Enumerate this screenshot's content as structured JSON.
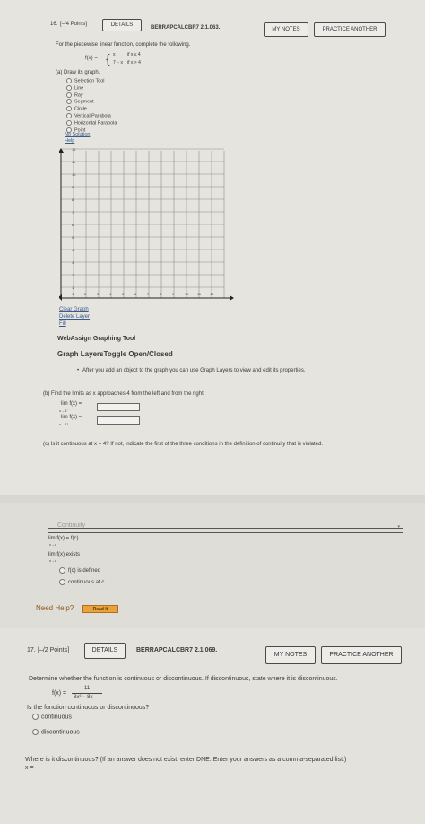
{
  "q16": {
    "number": "16.",
    "points": "[–/4 Points]",
    "details": "DETAILS",
    "code": "BERRAPCALCBR7 2.1.063.",
    "my_notes": "MY NOTES",
    "practice": "PRACTICE ANOTHER",
    "instruction": "For the piecewise linear function, complete the following.",
    "func_lhs": "f(x) =",
    "piece1_expr": "x",
    "piece1_cond": "if x ≤ 4",
    "piece2_expr": "7 − x",
    "piece2_cond": "if x > 4",
    "part_a": "(a)  Draw its graph.",
    "tools": [
      "Selection Tool",
      "Line",
      "Ray",
      "Segment",
      "Circle",
      "Vertical Parabola",
      "Horizontal Parabola",
      "Point"
    ],
    "no_solution": "No Solution",
    "help": "Help",
    "y_ticks": [
      "12",
      "11",
      "10",
      "9",
      "8",
      "7",
      "6",
      "5",
      "4",
      "3",
      "2",
      "1"
    ],
    "x_ticks": [
      "1",
      "2",
      "3",
      "4",
      "5",
      "6",
      "7",
      "8",
      "9",
      "10",
      "11",
      "12"
    ],
    "clear_graph": "Clear Graph",
    "delete_layer": "Delete Layer",
    "fill": "Fill",
    "tool_title": "WebAssign Graphing Tool",
    "layers_toggle": "Graph LayersToggle Open/Closed",
    "layers_note": "After you add an object to the graph you can use Graph Layers to view and edit its properties.",
    "part_b": "(b)  Find the limits as x approaches 4 from the left and from the right.",
    "lim_left": "lim  f(x)  =",
    "lim_left_sub": "x→4⁻",
    "lim_right": "lim  f(x)  =",
    "lim_right_sub": "x→4⁺",
    "part_c": "(c)  Is it continuous at x = 4? If not, indicate the first of the three conditions in the definition of continuity that is violated.",
    "dropdown_value": "Continuity",
    "cond1": "lim f(x) = f(c)",
    "cond1_sub": "x→c",
    "cond2": "lim f(x) exists",
    "cond2_sub": "x→c",
    "cond3": "f(c) is defined",
    "cond4": "continuous at c",
    "need_help": "Need Help?",
    "read_it": "Read It"
  },
  "q17": {
    "number": "17.",
    "points": "[–/2 Points]",
    "details": "DETAILS",
    "code": "BERRAPCALCBR7 2.1.069.",
    "my_notes": "MY NOTES",
    "practice": "PRACTICE ANOTHER",
    "instruction": "Determine whether the function is continuous or discontinuous. If discontinuous, state where it is discontinuous.",
    "func_lhs": "f(x) =",
    "numerator": "11",
    "denominator": "8x³ − 8x",
    "question": "Is the function continuous or discontinuous?",
    "opt1": "continuous",
    "opt2": "discontinuous",
    "where": "Where is it discontinuous? (If an answer does not exist, enter DNE. Enter your answers as a comma-separated list.)",
    "x_label": "x ="
  }
}
